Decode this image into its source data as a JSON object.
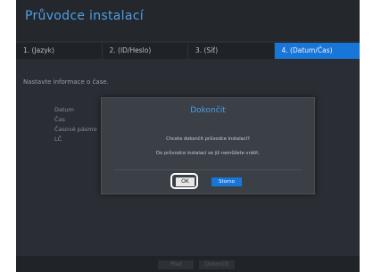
{
  "wizard": {
    "title": "Průvodce instalací",
    "steps": [
      {
        "label": "1. (Jazyk)",
        "active": false
      },
      {
        "label": "2. (ID/Heslo)",
        "active": false
      },
      {
        "label": "3. (Síť)",
        "active": false
      },
      {
        "label": "4. (Datum/Čas)",
        "active": true
      }
    ],
    "info_text": "Nastavte informace o čase.",
    "form_labels": [
      "Datum",
      "Čas",
      "Časové pásmo",
      "LČ"
    ],
    "footer": {
      "prev_label": "Před",
      "finish_label": "Dokončit"
    }
  },
  "dialog": {
    "title": "Dokončit",
    "line1": "Chcete dokončit průvodce instalací?",
    "line2": "Do průvodce instalací se již nemůžete vrátit.",
    "ok_label": "OK",
    "cancel_label": "Storno"
  },
  "colors": {
    "accent": "#1976d9",
    "title_blue": "#4f9fe8",
    "background": "#2a2d33"
  }
}
